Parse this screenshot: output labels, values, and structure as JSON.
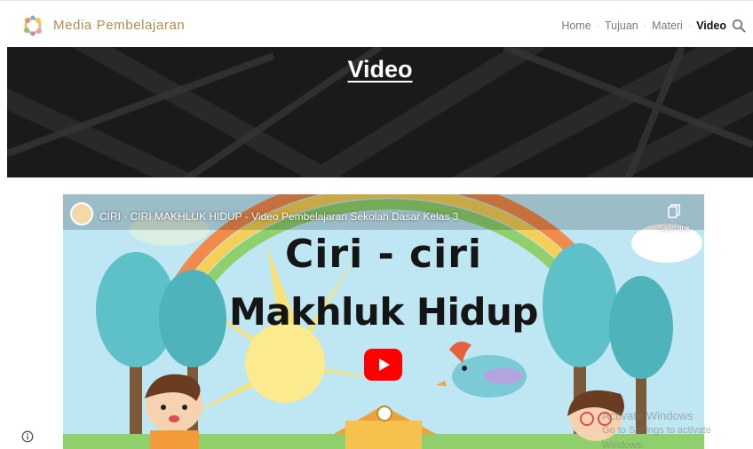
{
  "header": {
    "site_title": "Media Pembelajaran",
    "logo_icon": "flower-wreath-logo",
    "nav": [
      {
        "label": "Home",
        "active": false
      },
      {
        "label": "Tujuan",
        "active": false
      },
      {
        "label": "Materi",
        "active": false
      },
      {
        "label": "Video",
        "active": true
      }
    ],
    "search_icon": "search-icon"
  },
  "hero": {
    "title": "Video"
  },
  "video": {
    "title": "CIRI - CIRI MAKHLUK HIDUP - Video Pembelajaran Sekolah Dasar Kelas 3",
    "copy_link_label": "Salin link",
    "thumbnail_line1": "Ciri - ciri",
    "thumbnail_line2": "Makhluk Hidup",
    "play_icon": "youtube-play-icon"
  },
  "watermark": {
    "line1": "Activate Windows",
    "line2": "Go to Settings to activate Windows."
  },
  "colors": {
    "brand": "#b38b4d",
    "youtube_red": "#ff0000",
    "hero_bg": "#1f1f1f"
  }
}
